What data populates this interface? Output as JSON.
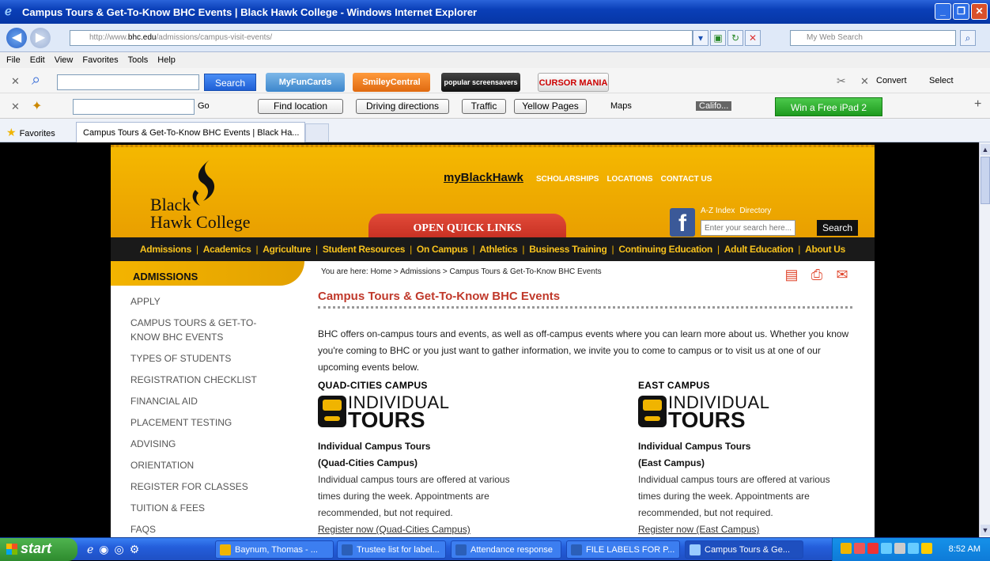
{
  "window": {
    "title": "Campus Tours & Get-To-Know BHC Events | Black Hawk College - Windows Internet Explorer"
  },
  "address": {
    "url_prefix": "http://www.",
    "url_domain": "bhc.edu",
    "url_path": "/admissions/campus-visit-events/",
    "search_placeholder": "My Web Search"
  },
  "menu": [
    "File",
    "Edit",
    "View",
    "Favorites",
    "Tools",
    "Help"
  ],
  "toolbar1": {
    "search_label": "Search",
    "myfuncards": "MyFunCards",
    "smiley": "SmileyCentral",
    "screensavers": "popular screensavers",
    "cursor": "CURSOR MANIA",
    "convert": "Convert",
    "select": "Select"
  },
  "toolbar2": {
    "go": "Go",
    "find_location": "Find location",
    "driving": "Driving directions",
    "traffic": "Traffic",
    "yellow": "Yellow Pages",
    "maps": "Maps",
    "calif": "Califo...",
    "ipad": "Win a Free iPad 2"
  },
  "favbar": {
    "favorites": "Favorites",
    "tab_title": "Campus Tours & Get-To-Know BHC Events | Black Ha..."
  },
  "site": {
    "logo_line1": "Black",
    "logo_line2": "Hawk College",
    "myblackhawk": "myBlackHawk",
    "toplinks": [
      "SCHOLARSHIPS",
      "LOCATIONS",
      "CONTACT US"
    ],
    "open_quick_links": "OPEN QUICK LINKS",
    "az_index": "A-Z Index",
    "directory": "Directory",
    "site_search_placeholder": "Enter your search here...",
    "site_search_button": "Search",
    "nav": [
      "Admissions",
      "Academics",
      "Agriculture",
      "Student Resources",
      "On Campus",
      "Athletics",
      "Business Training",
      "Continuing Education",
      "Adult Education",
      "About Us"
    ]
  },
  "sidebar": {
    "heading": "ADMISSIONS",
    "items": [
      "APPLY",
      "CAMPUS TOURS & GET-TO-KNOW BHC EVENTS",
      "TYPES OF STUDENTS",
      "REGISTRATION CHECKLIST",
      "FINANCIAL AID",
      "PLACEMENT TESTING",
      "ADVISING",
      "ORIENTATION",
      "REGISTER FOR CLASSES",
      "TUITION & FEES",
      "FAQS"
    ]
  },
  "main": {
    "breadcrumb": "You are here: Home > Admissions > Campus Tours & Get-To-Know BHC Events",
    "title": "Campus Tours & Get-To-Know BHC Events",
    "intro": "BHC offers on-campus tours and events, as well as off-campus events where you can learn more about us. Whether you know you're coming to BHC or you just want to gather information, we invite you to come to campus or to visit us at one of our upcoming events below.",
    "tours": [
      {
        "campus": "QUAD-CITIES CAMPUS",
        "logo_word1": "INDIVIDUAL",
        "logo_word2": "TOURS",
        "title": "Individual Campus Tours",
        "subtitle": "(Quad-Cities Campus)",
        "text": "Individual campus tours are offered at various times during the week. Appointments are recommended, but not required.",
        "link": "Register now (Quad-Cities Campus)"
      },
      {
        "campus": "EAST CAMPUS",
        "logo_word1": "INDIVIDUAL",
        "logo_word2": "TOURS",
        "title": "Individual Campus Tours",
        "subtitle": "(East Campus)",
        "text": "Individual campus tours are offered at various times during the week. Appointments are recommended, but not required.",
        "link": "Register now (East Campus)"
      }
    ]
  },
  "taskbar": {
    "start": "start",
    "tasks": [
      "Baynum, Thomas - ...",
      "Trustee list for label...",
      "Attendance response",
      "FILE LABELS FOR P...",
      "Campus Tours & Ge..."
    ],
    "clock": "8:52 AM"
  }
}
